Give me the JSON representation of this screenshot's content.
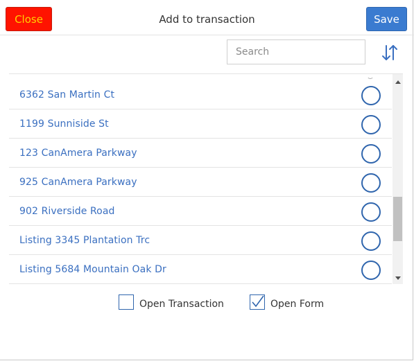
{
  "header": {
    "close_label": "Close",
    "title": "Add to transaction",
    "save_label": "Save"
  },
  "search": {
    "placeholder": "Search",
    "value": ""
  },
  "sort_icon": "sort-arrows-icon",
  "list": {
    "items": [
      {
        "label": "6362 San Martin Ct",
        "selected": false
      },
      {
        "label": "1199 Sunniside St",
        "selected": false
      },
      {
        "label": "123 CanAmera Parkway",
        "selected": false
      },
      {
        "label": "925 CanAmera Parkway",
        "selected": false
      },
      {
        "label": "902 Riverside Road",
        "selected": false
      },
      {
        "label": "Listing 3345 Plantation Trc",
        "selected": false
      },
      {
        "label": "Listing 5684 Mountain Oak Dr",
        "selected": false
      }
    ]
  },
  "options": {
    "open_transaction": {
      "label": "Open Transaction",
      "checked": false
    },
    "open_form": {
      "label": "Open Form",
      "checked": true
    }
  },
  "colors": {
    "close_bg": "#ff1300",
    "close_text": "#ffd200",
    "save_bg": "#3a7bd0",
    "link": "#3a6fc0",
    "radio": "#2f65ad"
  }
}
